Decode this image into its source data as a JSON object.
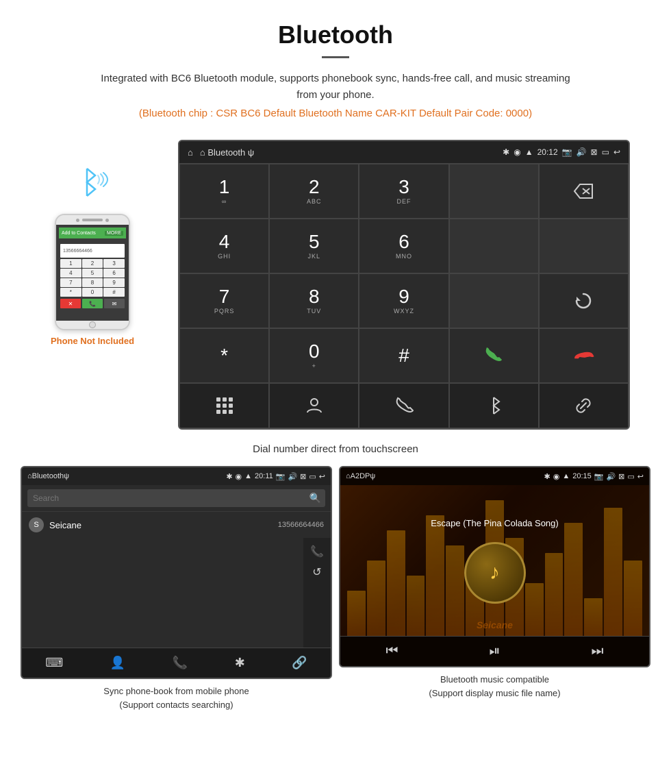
{
  "header": {
    "title": "Bluetooth",
    "description": "Integrated with BC6 Bluetooth module, supports phonebook sync, hands-free call, and music streaming from your phone.",
    "specs": "(Bluetooth chip : CSR BC6    Default Bluetooth Name CAR-KIT    Default Pair Code: 0000)"
  },
  "phone_label": "Phone Not Included",
  "dialpad": {
    "status_left": "⌂  Bluetooth  ψ",
    "status_time": "20:12",
    "keys": [
      {
        "num": "1",
        "sub": "∞"
      },
      {
        "num": "2",
        "sub": "ABC"
      },
      {
        "num": "3",
        "sub": "DEF"
      },
      {
        "num": "",
        "sub": ""
      },
      {
        "num": "⌫",
        "sub": ""
      },
      {
        "num": "4",
        "sub": "GHI"
      },
      {
        "num": "5",
        "sub": "JKL"
      },
      {
        "num": "6",
        "sub": "MNO"
      },
      {
        "num": "",
        "sub": ""
      },
      {
        "num": "",
        "sub": ""
      },
      {
        "num": "7",
        "sub": "PQRS"
      },
      {
        "num": "8",
        "sub": "TUV"
      },
      {
        "num": "9",
        "sub": "WXYZ"
      },
      {
        "num": "",
        "sub": ""
      },
      {
        "num": "↺",
        "sub": ""
      },
      {
        "num": "*",
        "sub": ""
      },
      {
        "num": "0",
        "sub": "+"
      },
      {
        "num": "#",
        "sub": ""
      },
      {
        "num": "📞",
        "sub": ""
      },
      {
        "num": "📵",
        "sub": ""
      }
    ],
    "caption": "Dial number direct from touchscreen"
  },
  "phonebook": {
    "status_time": "20:11",
    "title": "Bluetooth",
    "usb_icon": "ψ",
    "search_placeholder": "Search",
    "contacts": [
      {
        "letter": "S",
        "name": "Seicane",
        "phone": "13566664466"
      }
    ],
    "caption": "Sync phone-book from mobile phone\n(Support contacts searching)"
  },
  "music": {
    "status_time": "20:15",
    "source": "A2DP",
    "song_name": "Escape (The Pina Colada Song)",
    "caption": "Bluetooth music compatible\n(Support display music file name)"
  },
  "icons": {
    "home": "⌂",
    "back": "↩",
    "bluetooth": "✱",
    "phone_green": "📞",
    "phone_red": "📵",
    "person": "👤",
    "dial": "⌨",
    "link": "🔗",
    "search": "🔍",
    "refresh": "↺",
    "play_pause": "⏯",
    "prev": "⏮",
    "next": "⏭",
    "music_note": "♪"
  },
  "colors": {
    "accent_orange": "#e07020",
    "bg_dark": "#2b2b2b",
    "green_call": "#4caf50",
    "red_call": "#e53935"
  }
}
